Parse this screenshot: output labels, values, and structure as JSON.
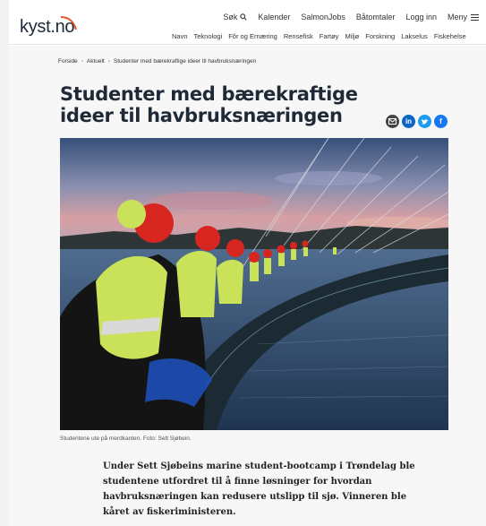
{
  "header": {
    "logo_text": "kyst.no",
    "top_links": [
      "Søk",
      "Kalender",
      "SalmonJobs",
      "Båtomtaler",
      "Logg inn",
      "Meny"
    ],
    "categories": [
      "Navn",
      "Teknologi",
      "Fôr og Ernæring",
      "Rensefisk",
      "Fartøy",
      "Miljø",
      "Forskning",
      "Lakselus",
      "Fiskehelse"
    ]
  },
  "breadcrumb": [
    "Forside",
    "Aktuelt",
    "Studenter med bærekraftige ideer til havbruksnæringen"
  ],
  "article": {
    "headline": "Studenter med bærekraftige ideer til havbruksnæringen",
    "caption": "Studentene ute på merdkanten. Foto: Sett Sjøbein.",
    "lead": "Under Sett Sjøbeins marine student-bootcamp i Trøndelag ble studentene utfordret til å finne løsninger for hvordan havbruksnæringen kan redusere utslipp til sjø. Vinneren ble kåret av fiskeriministeren."
  },
  "share": {
    "mail_icon": "envelope-icon",
    "linkedin_label": "in",
    "twitter_icon": "twitter-bird-icon",
    "facebook_label": "f"
  },
  "colors": {
    "brand_dark": "#1d2a3a",
    "logo_accent": "#e8542c",
    "linkedin": "#0a66c2",
    "twitter": "#1d9bf0",
    "facebook": "#1877f2"
  }
}
